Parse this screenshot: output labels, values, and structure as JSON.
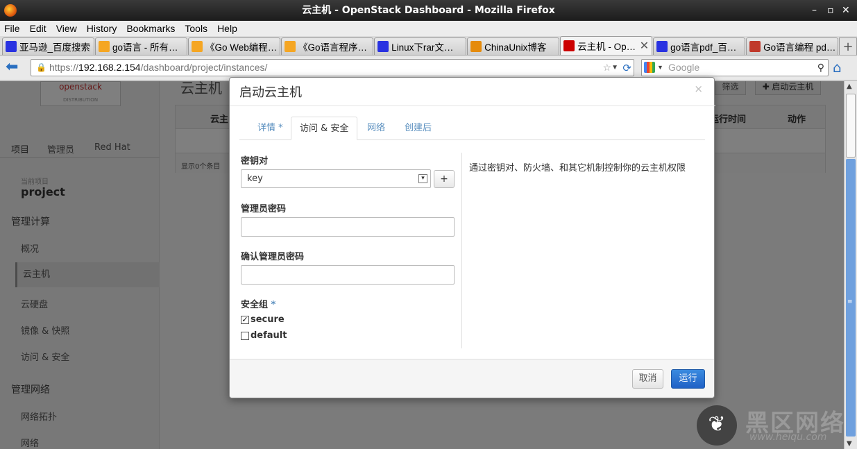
{
  "window": {
    "title": "云主机 - OpenStack Dashboard - Mozilla Firefox"
  },
  "menu": [
    "File",
    "Edit",
    "View",
    "History",
    "Bookmarks",
    "Tools",
    "Help"
  ],
  "tabs": [
    {
      "label": "亚马逊_百度搜索",
      "icon": "baidu-icon",
      "color": "#2932e1"
    },
    {
      "label": "go语言 - 所有…",
      "icon": "amazon-icon",
      "color": "#f5a623"
    },
    {
      "label": "《Go Web编程…",
      "icon": "amazon-icon",
      "color": "#f5a623"
    },
    {
      "label": "《Go语言程序…",
      "icon": "amazon-icon",
      "color": "#f5a623"
    },
    {
      "label": "Linux下rar文…",
      "icon": "baidu-icon",
      "color": "#2932e1"
    },
    {
      "label": "ChinaUnix博客",
      "icon": "chinaunix-icon",
      "color": "#e58b0c"
    },
    {
      "label": "云主机 - Op…",
      "icon": "redhat-icon",
      "color": "#cc0000",
      "active": true
    },
    {
      "label": "go语言pdf_百…",
      "icon": "baidu-icon",
      "color": "#2932e1"
    },
    {
      "label": "Go语言编程 pd…",
      "icon": "jb-icon",
      "color": "#c0392b"
    }
  ],
  "nav": {
    "url_prefix": "https://",
    "url_host": "192.168.2.154",
    "url_path": "/dashboard/project/instances/",
    "search_placeholder": "Google"
  },
  "sidebar": {
    "logo_text": "openstack",
    "logo_sub": "DISTRIBUTION",
    "tabs": [
      "项目",
      "管理员",
      "Red Hat"
    ],
    "project_label": "当前项目",
    "project_name": "project",
    "section1": "管理计算",
    "items1": [
      "概况",
      "云主机",
      "云硬盘",
      "镜像 & 快照",
      "访问 & 安全"
    ],
    "section2": "管理网络",
    "items2": [
      "网络拓扑",
      "网络"
    ]
  },
  "main": {
    "title": "云主机",
    "filter_label": "筛选",
    "launch_label": "✚ 启动云主机",
    "col_name": "云主",
    "col_uptime": "运行时间",
    "col_actions": "动作",
    "footer": "显示0个条目"
  },
  "modal": {
    "title": "启动云主机",
    "close": "×",
    "tabs": [
      {
        "label": "详情",
        "required": true
      },
      {
        "label": "访问 & 安全",
        "required": false,
        "active": true
      },
      {
        "label": "网络",
        "required": false
      },
      {
        "label": "创建后",
        "required": false
      }
    ],
    "keypair_label": "密钥对",
    "keypair_value": "key",
    "add_label": "+",
    "admin_pass_label": "管理员密码",
    "confirm_pass_label": "确认管理员密码",
    "secgroup_label": "安全组",
    "required_mark": "*",
    "secgroups": [
      {
        "name": "secure",
        "checked": true
      },
      {
        "name": "default",
        "checked": false
      }
    ],
    "help": "通过密钥对、防火墙、和其它机制控制你的云主机权限",
    "cancel_label": "取消",
    "run_label": "运行"
  },
  "watermark": {
    "text": "黑区网络",
    "url": "www.heiqu.com"
  }
}
